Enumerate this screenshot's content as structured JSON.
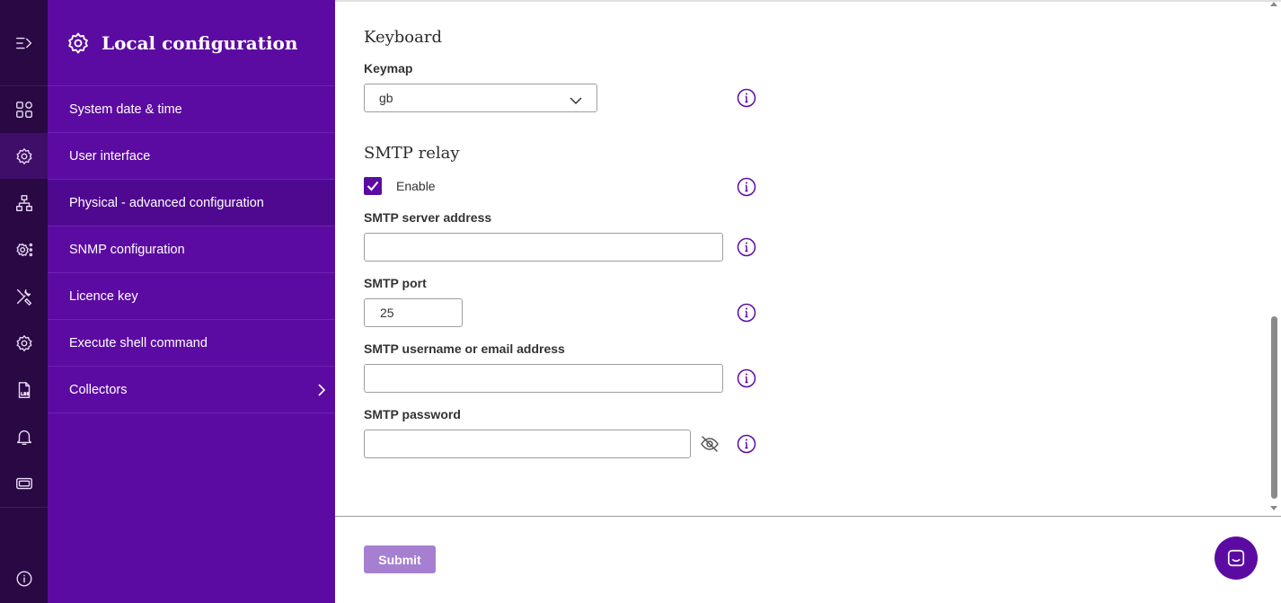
{
  "colors": {
    "rail_bg": "#2a0844",
    "nav_bg": "#5c0ba2",
    "accent": "#5c0ba2",
    "submit_disabled": "#a67fd1"
  },
  "rail": {
    "items": [
      {
        "icon": "collapse-menu-icon"
      },
      {
        "icon": "dashboard-grid-icon"
      },
      {
        "icon": "settings-cog-icon",
        "active": true
      },
      {
        "icon": "network-topology-icon"
      },
      {
        "icon": "cog-network-icon"
      },
      {
        "icon": "tools-icon"
      },
      {
        "icon": "gear-icon"
      },
      {
        "icon": "log-file-icon"
      },
      {
        "icon": "bell-icon"
      },
      {
        "icon": "ticket-icon"
      },
      {
        "icon": "info-icon"
      }
    ]
  },
  "nav": {
    "title": "Local configuration",
    "items": [
      {
        "label": "System date & time"
      },
      {
        "label": "User interface"
      },
      {
        "label": "Physical - advanced configuration",
        "active": true
      },
      {
        "label": "SNMP configuration"
      },
      {
        "label": "Licence key"
      },
      {
        "label": "Execute shell command"
      },
      {
        "label": "Collectors",
        "has_children": true
      }
    ]
  },
  "form": {
    "keyboard": {
      "title": "Keyboard",
      "keymap_label": "Keymap",
      "keymap_value": "gb"
    },
    "smtp": {
      "title": "SMTP relay",
      "enable_label": "Enable",
      "enable_checked": true,
      "server_label": "SMTP server address",
      "server_value": "",
      "port_label": "SMTP port",
      "port_value": "25",
      "username_label": "SMTP username or email address",
      "username_value": "",
      "password_label": "SMTP password",
      "password_value": ""
    },
    "submit_label": "Submit"
  }
}
